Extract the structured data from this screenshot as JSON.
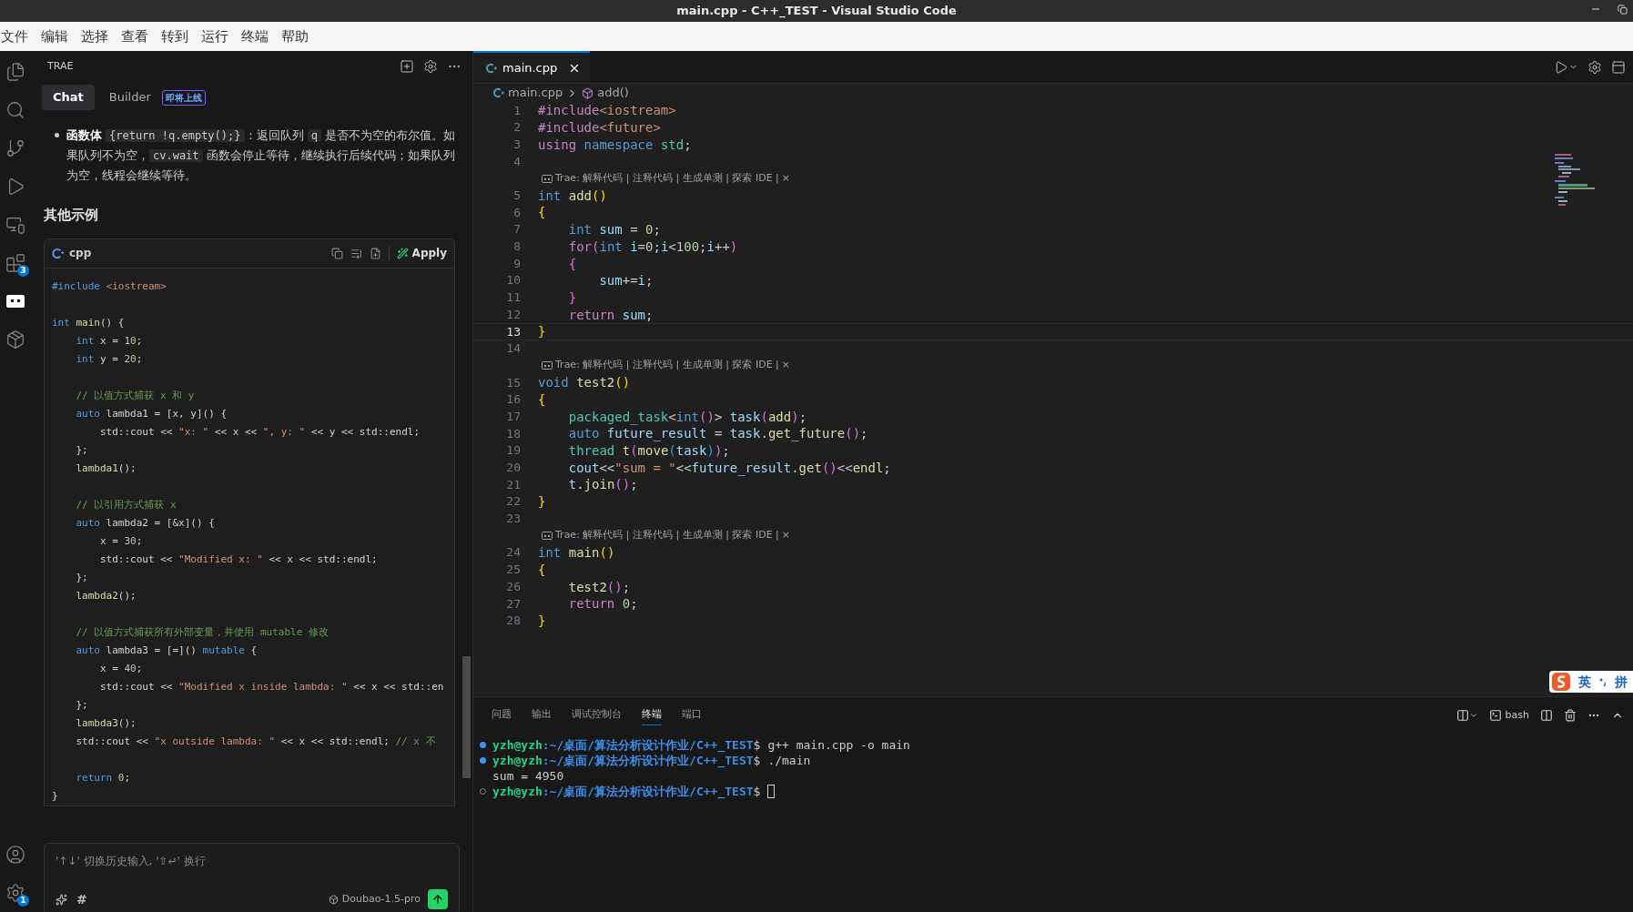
{
  "window": {
    "title": "main.cpp - C++_TEST - Visual Studio Code"
  },
  "menu": [
    "文件",
    "编辑",
    "选择",
    "查看",
    "转到",
    "运行",
    "终端",
    "帮助"
  ],
  "activity_bar": {
    "top": [
      {
        "kind": "files",
        "selected": false
      },
      {
        "kind": "search",
        "selected": false
      },
      {
        "kind": "branch",
        "selected": false
      },
      {
        "kind": "run",
        "selected": false
      },
      {
        "kind": "remote",
        "selected": false
      },
      {
        "kind": "extensions",
        "selected": false,
        "badge": "3"
      },
      {
        "kind": "chat",
        "selected": true
      },
      {
        "kind": "box",
        "selected": false
      }
    ],
    "bottom": [
      {
        "kind": "account",
        "selected": false
      },
      {
        "kind": "settings",
        "selected": false,
        "badge": "1"
      }
    ]
  },
  "side_panel": {
    "title": "TRAE",
    "tabs": [
      {
        "label": "Chat",
        "selected": true
      },
      {
        "label": "Builder",
        "selected": false,
        "badge": "即将上线"
      }
    ],
    "bullet": [
      {
        "kind": "bold",
        "text": "函数体"
      },
      {
        "kind": "code",
        "text": "{return !q.empty();}"
      },
      {
        "kind": "text",
        "text": "：返回队列 "
      },
      {
        "kind": "code",
        "text": "q"
      },
      {
        "kind": "text",
        "text": " 是否不为空的布尔值。如果队列不为空，"
      },
      {
        "kind": "code",
        "text": "cv.wait"
      },
      {
        "kind": "text",
        "text": " 函数会停止等待，继续执行后续代码；如果队列为空，线程会继续等待。"
      }
    ],
    "heading": "其他示例",
    "code_block": {
      "language": "cpp",
      "apply": "Apply",
      "groups": [
        [
          [
            {
              "kind": "kw",
              "text": "#include"
            },
            {
              "kind": "str",
              "text": " <iostream>"
            }
          ]
        ],
        [
          [
            {
              "kind": "kw",
              "text": "int"
            },
            {
              "kind": "fn",
              "text": " main"
            },
            {
              "kind": "plain",
              "text": "() {"
            }
          ],
          [
            {
              "kind": "kw",
              "text": "    int"
            },
            {
              "kind": "plain",
              "text": " x = "
            },
            {
              "kind": "num",
              "text": "10"
            },
            {
              "kind": "plain",
              "text": ";"
            }
          ],
          [
            {
              "kind": "kw",
              "text": "    int"
            },
            {
              "kind": "plain",
              "text": " y = "
            },
            {
              "kind": "num",
              "text": "20"
            },
            {
              "kind": "plain",
              "text": ";"
            }
          ]
        ],
        [
          [
            {
              "kind": "com",
              "text": "    // 以值方式捕获 x 和 y"
            }
          ],
          [
            {
              "kind": "kw",
              "text": "    auto"
            },
            {
              "kind": "plain",
              "text": " lambda1 = [x, y]() {"
            }
          ],
          [
            {
              "kind": "plain",
              "text": "        std::cout << "
            },
            {
              "kind": "str",
              "text": "\"x: \""
            },
            {
              "kind": "plain",
              "text": " << x << "
            },
            {
              "kind": "str",
              "text": "\", y: \""
            },
            {
              "kind": "plain",
              "text": " << y << std::endl;"
            }
          ],
          [
            {
              "kind": "plain",
              "text": "    };"
            }
          ],
          [
            {
              "kind": "fn",
              "text": "    lambda1"
            },
            {
              "kind": "plain",
              "text": "();"
            }
          ]
        ],
        [
          [
            {
              "kind": "com",
              "text": "    // 以引用方式捕获 x"
            }
          ],
          [
            {
              "kind": "kw",
              "text": "    auto"
            },
            {
              "kind": "plain",
              "text": " lambda2 = [&x]() {"
            }
          ],
          [
            {
              "kind": "plain",
              "text": "        x = "
            },
            {
              "kind": "num",
              "text": "30"
            },
            {
              "kind": "plain",
              "text": ";"
            }
          ],
          [
            {
              "kind": "plain",
              "text": "        std::cout << "
            },
            {
              "kind": "str",
              "text": "\"Modified x: \""
            },
            {
              "kind": "plain",
              "text": " << x << std::endl;"
            }
          ],
          [
            {
              "kind": "plain",
              "text": "    };"
            }
          ],
          [
            {
              "kind": "fn",
              "text": "    lambda2"
            },
            {
              "kind": "plain",
              "text": "();"
            }
          ]
        ],
        [
          [
            {
              "kind": "com",
              "text": "    // 以值方式捕获所有外部变量，并使用 mutable 修改"
            }
          ],
          [
            {
              "kind": "kw",
              "text": "    auto"
            },
            {
              "kind": "plain",
              "text": " lambda3 = [=]() "
            },
            {
              "kind": "kw",
              "text": "mutable"
            },
            {
              "kind": "plain",
              "text": " {"
            }
          ],
          [
            {
              "kind": "plain",
              "text": "        x = "
            },
            {
              "kind": "num",
              "text": "40"
            },
            {
              "kind": "plain",
              "text": ";"
            }
          ],
          [
            {
              "kind": "plain",
              "text": "        std::cout << "
            },
            {
              "kind": "str",
              "text": "\"Modified x inside lambda: \""
            },
            {
              "kind": "plain",
              "text": " << x << std::en"
            }
          ],
          [
            {
              "kind": "plain",
              "text": "    };"
            }
          ],
          [
            {
              "kind": "fn",
              "text": "    lambda3"
            },
            {
              "kind": "plain",
              "text": "();"
            }
          ],
          [
            {
              "kind": "plain",
              "text": "    std::cout << "
            },
            {
              "kind": "str",
              "text": "\"x outside lambda: \""
            },
            {
              "kind": "plain",
              "text": " << x << std::endl; "
            },
            {
              "kind": "com",
              "text": "// x 不"
            }
          ]
        ],
        [
          [
            {
              "kind": "kw",
              "text": "    return"
            },
            {
              "kind": "num",
              "text": " 0"
            },
            {
              "kind": "plain",
              "text": ";"
            }
          ],
          [
            {
              "kind": "plain",
              "text": "}"
            }
          ]
        ]
      ]
    },
    "input": {
      "placeholder": "'↑↓' 切换历史输入, '⇧↵' 换行",
      "hash": "#",
      "model": "Doubao-1.5-pro"
    }
  },
  "editor": {
    "tabs": [
      {
        "label": "main.cpp",
        "selected": true
      }
    ],
    "breadcrumb": {
      "file": "main.cpp",
      "symbol": "add()"
    },
    "rows": [
      {
        "kind": "code",
        "number": "1",
        "current": false,
        "tokens": [
          {
            "kind": "pp",
            "text": "#include"
          },
          {
            "kind": "str",
            "text": "<iostream>"
          }
        ]
      },
      {
        "kind": "code",
        "number": "2",
        "current": false,
        "tokens": [
          {
            "kind": "pp",
            "text": "#include"
          },
          {
            "kind": "str",
            "text": "<future>"
          }
        ]
      },
      {
        "kind": "code",
        "number": "3",
        "current": false,
        "tokens": [
          {
            "kind": "ctrl",
            "text": "using"
          },
          {
            "kind": "kw",
            "text": " namespace"
          },
          {
            "kind": "type",
            "text": " std"
          },
          {
            "kind": "plain",
            "text": ";"
          }
        ]
      },
      {
        "kind": "code",
        "number": "4",
        "current": false
      },
      {
        "kind": "lens",
        "text": "Trae: 解释代码 | 注释代码 | 生成单测 | 探索 IDE |",
        "close": "×"
      },
      {
        "kind": "code",
        "number": "5",
        "current": false,
        "tokens": [
          {
            "kind": "kw",
            "text": "int"
          },
          {
            "kind": "fn",
            "text": " add"
          },
          {
            "kind": "b1",
            "text": "()"
          }
        ]
      },
      {
        "kind": "code",
        "number": "6",
        "current": false,
        "tokens": [
          {
            "kind": "b1",
            "text": "{"
          }
        ]
      },
      {
        "kind": "code",
        "number": "7",
        "current": false,
        "tokens": [
          {
            "kind": "kw",
            "text": "    int"
          },
          {
            "kind": "var",
            "text": " sum"
          },
          {
            "kind": "plain",
            "text": " = "
          },
          {
            "kind": "num",
            "text": "0"
          },
          {
            "kind": "plain",
            "text": ";"
          }
        ]
      },
      {
        "kind": "code",
        "number": "8",
        "current": false,
        "tokens": [
          {
            "kind": "ctrl",
            "text": "    for"
          },
          {
            "kind": "b2",
            "text": "("
          },
          {
            "kind": "kw",
            "text": "int"
          },
          {
            "kind": "var",
            "text": " i"
          },
          {
            "kind": "plain",
            "text": "="
          },
          {
            "kind": "num",
            "text": "0"
          },
          {
            "kind": "plain",
            "text": ";"
          },
          {
            "kind": "var",
            "text": "i"
          },
          {
            "kind": "plain",
            "text": "<"
          },
          {
            "kind": "num",
            "text": "100"
          },
          {
            "kind": "plain",
            "text": ";"
          },
          {
            "kind": "var",
            "text": "i"
          },
          {
            "kind": "plain",
            "text": "++"
          },
          {
            "kind": "b2",
            "text": ")"
          }
        ]
      },
      {
        "kind": "code",
        "number": "9",
        "current": false,
        "tokens": [
          {
            "kind": "b2",
            "text": "    {"
          }
        ]
      },
      {
        "kind": "code",
        "number": "10",
        "current": false,
        "tokens": [
          {
            "kind": "var",
            "text": "        sum"
          },
          {
            "kind": "plain",
            "text": "+="
          },
          {
            "kind": "var",
            "text": "i"
          },
          {
            "kind": "plain",
            "text": ";"
          }
        ]
      },
      {
        "kind": "code",
        "number": "11",
        "current": false,
        "tokens": [
          {
            "kind": "b2",
            "text": "    }"
          }
        ]
      },
      {
        "kind": "code",
        "number": "12",
        "current": false,
        "tokens": [
          {
            "kind": "ctrl",
            "text": "    return"
          },
          {
            "kind": "var",
            "text": " sum"
          },
          {
            "kind": "plain",
            "text": ";"
          }
        ]
      },
      {
        "kind": "code",
        "number": "13",
        "current": true,
        "tokens": [
          {
            "kind": "b1",
            "text": "}"
          }
        ]
      },
      {
        "kind": "code",
        "number": "14",
        "current": false
      },
      {
        "kind": "lens",
        "text": "Trae: 解释代码 | 注释代码 | 生成单测 | 探索 IDE |",
        "close": "×"
      },
      {
        "kind": "code",
        "number": "15",
        "current": false,
        "tokens": [
          {
            "kind": "kw",
            "text": "void"
          },
          {
            "kind": "fn",
            "text": " test2"
          },
          {
            "kind": "b1",
            "text": "()"
          }
        ]
      },
      {
        "kind": "code",
        "number": "16",
        "current": false,
        "tokens": [
          {
            "kind": "b1",
            "text": "{"
          }
        ]
      },
      {
        "kind": "code",
        "number": "17",
        "current": false,
        "tokens": [
          {
            "kind": "type",
            "text": "    packaged_task"
          },
          {
            "kind": "plain",
            "text": "<"
          },
          {
            "kind": "kw",
            "text": "int"
          },
          {
            "kind": "b2",
            "text": "()"
          },
          {
            "kind": "plain",
            "text": ">"
          },
          {
            "kind": "var",
            "text": " task"
          },
          {
            "kind": "b2",
            "text": "("
          },
          {
            "kind": "fn",
            "text": "add"
          },
          {
            "kind": "b2",
            "text": ")"
          },
          {
            "kind": "plain",
            "text": ";"
          }
        ]
      },
      {
        "kind": "code",
        "number": "18",
        "current": false,
        "tokens": [
          {
            "kind": "kw",
            "text": "    auto"
          },
          {
            "kind": "var",
            "text": " future_result"
          },
          {
            "kind": "plain",
            "text": " = "
          },
          {
            "kind": "var",
            "text": "task"
          },
          {
            "kind": "plain",
            "text": "."
          },
          {
            "kind": "fn",
            "text": "get_future"
          },
          {
            "kind": "b2",
            "text": "()"
          },
          {
            "kind": "plain",
            "text": ";"
          }
        ]
      },
      {
        "kind": "code",
        "number": "19",
        "current": false,
        "tokens": [
          {
            "kind": "type",
            "text": "    thread"
          },
          {
            "kind": "fn",
            "text": " t"
          },
          {
            "kind": "b2",
            "text": "("
          },
          {
            "kind": "fn",
            "text": "move"
          },
          {
            "kind": "b3",
            "text": "("
          },
          {
            "kind": "var",
            "text": "task"
          },
          {
            "kind": "b3",
            "text": ")"
          },
          {
            "kind": "b2",
            "text": ")"
          },
          {
            "kind": "plain",
            "text": ";"
          }
        ]
      },
      {
        "kind": "code",
        "number": "20",
        "current": false,
        "tokens": [
          {
            "kind": "var",
            "text": "    cout"
          },
          {
            "kind": "plain",
            "text": "<<"
          },
          {
            "kind": "str",
            "text": "\"sum = \""
          },
          {
            "kind": "plain",
            "text": "<<"
          },
          {
            "kind": "var",
            "text": "future_result"
          },
          {
            "kind": "plain",
            "text": "."
          },
          {
            "kind": "fn",
            "text": "get"
          },
          {
            "kind": "b2",
            "text": "()"
          },
          {
            "kind": "plain",
            "text": "<<"
          },
          {
            "kind": "fn",
            "text": "endl"
          },
          {
            "kind": "plain",
            "text": ";"
          }
        ]
      },
      {
        "kind": "code",
        "number": "21",
        "current": false,
        "tokens": [
          {
            "kind": "var",
            "text": "    t"
          },
          {
            "kind": "plain",
            "text": "."
          },
          {
            "kind": "fn",
            "text": "join"
          },
          {
            "kind": "b2",
            "text": "()"
          },
          {
            "kind": "plain",
            "text": ";"
          }
        ]
      },
      {
        "kind": "code",
        "number": "22",
        "current": false,
        "tokens": [
          {
            "kind": "b1",
            "text": "}"
          }
        ]
      },
      {
        "kind": "code",
        "number": "23",
        "current": false
      },
      {
        "kind": "lens",
        "text": "Trae: 解释代码 | 注释代码 | 生成单测 | 探索 IDE |",
        "close": "×"
      },
      {
        "kind": "code",
        "number": "24",
        "current": false,
        "tokens": [
          {
            "kind": "kw",
            "text": "int"
          },
          {
            "kind": "fn",
            "text": " main"
          },
          {
            "kind": "b1",
            "text": "()"
          }
        ]
      },
      {
        "kind": "code",
        "number": "25",
        "current": false,
        "tokens": [
          {
            "kind": "b1",
            "text": "{"
          }
        ]
      },
      {
        "kind": "code",
        "number": "26",
        "current": false,
        "tokens": [
          {
            "kind": "fn",
            "text": "    test2"
          },
          {
            "kind": "b2",
            "text": "()"
          },
          {
            "kind": "plain",
            "text": ";"
          }
        ]
      },
      {
        "kind": "code",
        "number": "27",
        "current": false,
        "tokens": [
          {
            "kind": "ctrl",
            "text": "    return"
          },
          {
            "kind": "num",
            "text": " 0"
          },
          {
            "kind": "plain",
            "text": ";"
          }
        ]
      },
      {
        "kind": "code",
        "number": "28",
        "current": false,
        "tokens": [
          {
            "kind": "b1",
            "text": "}"
          }
        ]
      }
    ]
  },
  "ime": {
    "mode": "英",
    "layout": "拼"
  },
  "panel": {
    "tabs": [
      {
        "label": "问题",
        "selected": false
      },
      {
        "label": "输出",
        "selected": false
      },
      {
        "label": "调试控制台",
        "selected": false
      },
      {
        "label": "终端",
        "selected": true
      },
      {
        "label": "端口",
        "selected": false
      }
    ],
    "shell": "bash",
    "lines": [
      {
        "kind": "prompt",
        "succeeded": true,
        "user": "yzh@yzh",
        "path": ":~/桌面/算法分析设计作业/C++_TEST",
        "symbol": "$",
        "command": "g++ main.cpp -o main",
        "cursor": false
      },
      {
        "kind": "prompt",
        "succeeded": true,
        "user": "yzh@yzh",
        "path": ":~/桌面/算法分析设计作业/C++_TEST",
        "symbol": "$",
        "command": "./main",
        "cursor": false
      },
      {
        "kind": "output",
        "text": "sum = 4950"
      },
      {
        "kind": "prompt",
        "succeeded": false,
        "user": "yzh@yzh",
        "path": ":~/桌面/算法分析设计作业/C++_TEST",
        "symbol": "$",
        "cursor": true
      }
    ]
  }
}
